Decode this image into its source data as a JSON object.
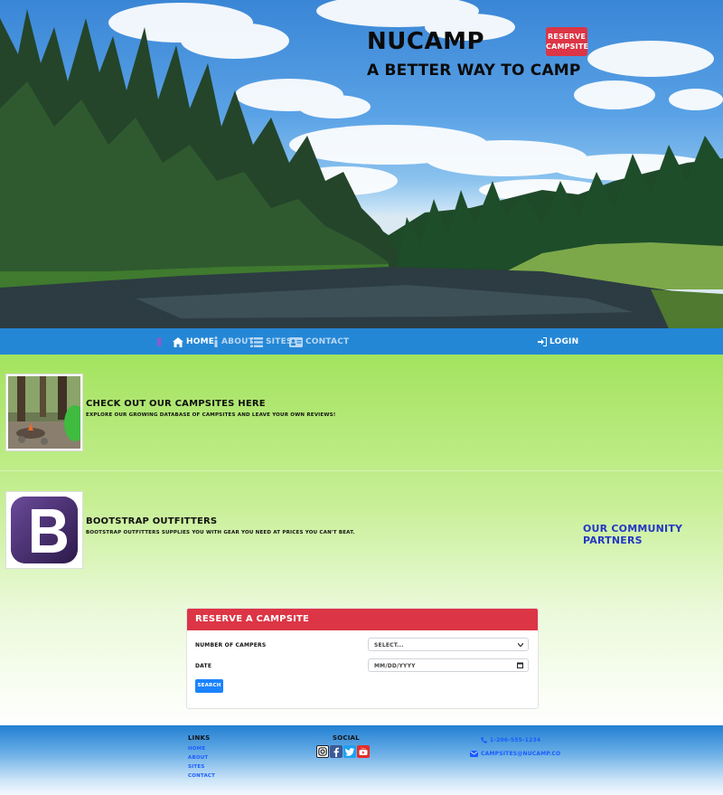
{
  "brand": {
    "name": "NUCAMP",
    "tagline": "A BETTER WAY TO CAMP",
    "reserve_button": "RESERVE CAMPSITE",
    "reserve_line1": "RESERVE",
    "reserve_line2": "CAMPSITE"
  },
  "nav": {
    "items": [
      {
        "label": "HOME",
        "icon": "home-icon",
        "active": true
      },
      {
        "label": "ABOUT",
        "icon": "info-icon",
        "active": false
      },
      {
        "label": "SITES",
        "icon": "list-icon",
        "active": false
      },
      {
        "label": "CONTACT",
        "icon": "address-card-icon",
        "active": false
      }
    ],
    "login": "LOGIN"
  },
  "features": [
    {
      "title": "CHECK OUT OUR CAMPSITES HERE",
      "text": "EXPLORE OUR GROWING DATABASE OF CAMPSITES AND LEAVE YOUR OWN REVIEWS!"
    },
    {
      "title": "BOOTSTRAP OUTFITTERS",
      "text": "BOOTSTRAP OUTFITTERS SUPPLIES YOU WITH GEAR YOU NEED AT PRICES YOU CAN'T BEAT."
    }
  ],
  "partners_heading": "OUR COMMUNITY PARTNERS",
  "reserve_form": {
    "header": "RESERVE A CAMPSITE",
    "campers_label": "NUMBER OF CAMPERS",
    "campers_value": "SELECT...",
    "date_label": "DATE",
    "date_placeholder": "MM/DD/YYYY",
    "search_button": "SEARCH"
  },
  "footer": {
    "links_heading": "LINKS",
    "links": [
      "HOME",
      "ABOUT",
      "SITES",
      "CONTACT"
    ],
    "social_heading": "SOCIAL",
    "social": [
      "instagram-icon",
      "facebook-icon",
      "twitter-icon",
      "youtube-icon"
    ],
    "phone": "1-206-555-1234",
    "email": "CAMPSITES@NUCAMP.CO"
  },
  "colors": {
    "accent_red": "#dc3545",
    "nav_blue": "#2487d6",
    "link_blue": "#1a5cff",
    "partners_blue": "#2437c4"
  }
}
